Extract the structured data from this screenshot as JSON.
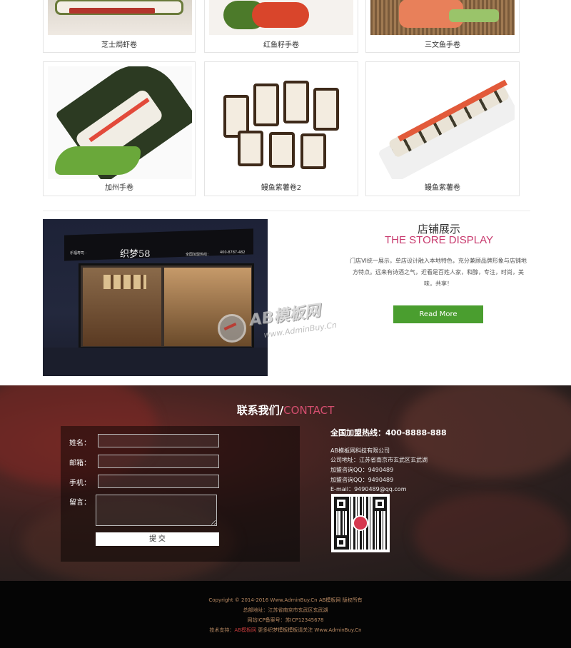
{
  "products": [
    {
      "name": "芝士焗虾卷"
    },
    {
      "name": "红鱼籽手卷"
    },
    {
      "name": "三文鱼手卷"
    },
    {
      "name": "加州手卷"
    },
    {
      "name": "鳗鱼紫薯卷2"
    },
    {
      "name": "鳗鱼紫薯卷"
    }
  ],
  "store": {
    "title": "店铺展示",
    "subtitle": "THE STORE DISPLAY",
    "description": "门店VI统一展示，单店设计融入本地特色，充分兼顾品牌形象与店铺地方特点。远来有诗酒之气，近看是百姓人家，和醇，专注，时尚，美味，共享！",
    "read_more": "Read More",
    "sign_text": "织梦58",
    "sign_left": "乐福寿司 ·",
    "sign_right": "全国加盟热线：",
    "sign_phone": "400-8787-482"
  },
  "watermark": {
    "text": "AB模板网",
    "url": "www.AdminBuy.Cn"
  },
  "contact": {
    "title_cn": "联系我们/",
    "title_en": "CONTACT",
    "form": {
      "name_label": "姓名：",
      "email_label": "邮箱：",
      "phone_label": "手机：",
      "message_label": "留言：",
      "submit_label": "提 交"
    },
    "hotline": "全国加盟热线：400-8888-888",
    "company": "AB模板网科技有限公司",
    "address": "公司地址：江苏省南京市玄武区玄武湖",
    "qq1": "加盟咨询QQ：9490489",
    "qq2": "加盟咨询QQ：9490489",
    "email": "E-mail：9490489@qq.com"
  },
  "footer": {
    "copyright": "Copyright © 2014-2016 Www.AdminBuy.Cn AB模板网 版权所有",
    "hq_address": "总部地址：江苏省南京市玄武区玄武湖",
    "icp": "网站ICP备案号：苏ICP12345678",
    "support_prefix": "技术支持：",
    "support_link": "AB模板网",
    "support_suffix": " 更多织梦模板模板请关注 Www.AdminBuy.Cn"
  },
  "colors": {
    "accent_pink": "#c83a6e",
    "button_green": "#4a9e2f",
    "footer_text": "#b98a63"
  }
}
